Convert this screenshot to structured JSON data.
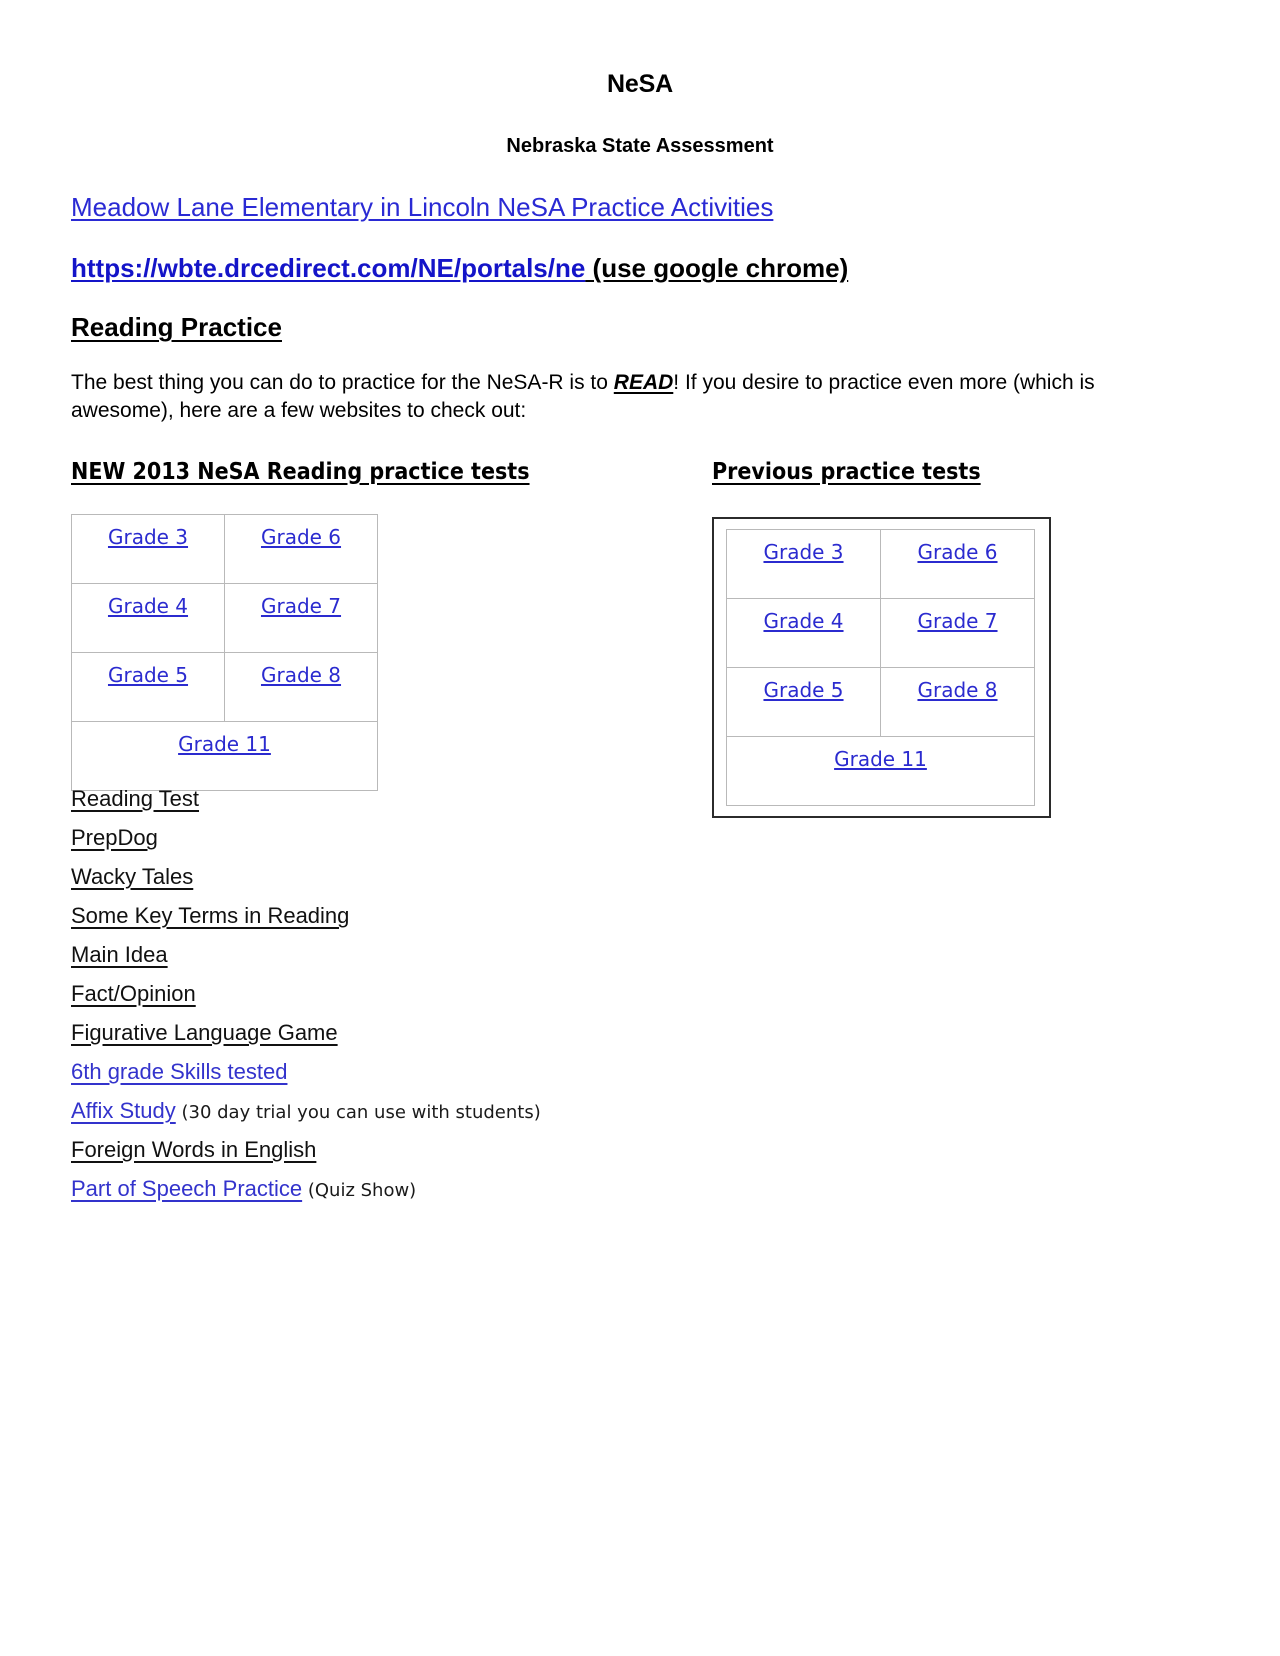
{
  "document": {
    "title": "NeSA",
    "subtitle": "Nebraska State Assessment",
    "lead_link": "Meadow Lane Elementary in Lincoln NeSA Practice Activities",
    "url_text": "https://wbte.drcedirect.com/NE/portals/ne",
    "url_note": " (use google chrome)",
    "section_heading": "Reading Practice",
    "paragraph": {
      "part1": "The best thing you can do to practice for the NeSA-R is to ",
      "emphasis": "READ",
      "part2": "!   If you desire to practice even more (which is awesome), here are a few websites to check out:"
    }
  },
  "columns": {
    "left": {
      "heading": "NEW 2013 NeSA Reading practice tests ",
      "table": {
        "rows": [
          [
            "Grade 3",
            "Grade 6"
          ],
          [
            "Grade 4",
            "Grade 7"
          ],
          [
            "Grade 5",
            "Grade 8"
          ]
        ],
        "full_width_row": "Grade 11"
      }
    },
    "right": {
      "heading": "Previous practice tests",
      "table": {
        "rows": [
          [
            "Grade 3",
            "Grade 6"
          ],
          [
            "Grade 4",
            "Grade 7"
          ],
          [
            "Grade 5",
            "Grade 8"
          ]
        ],
        "full_width_row": "Grade 11"
      }
    }
  },
  "resource_links": [
    {
      "label": " Reading Test",
      "color": "black",
      "note": ""
    },
    {
      "label": "PrepDog",
      "color": "black",
      "note": ""
    },
    {
      "label": "Wacky Tales",
      "color": "black",
      "note": ""
    },
    {
      "label": "Some Key Terms in Reading",
      "color": "black",
      "note": ""
    },
    {
      "label": "Main Idea",
      "color": "black",
      "note": ""
    },
    {
      "label": "Fact/Opinion",
      "color": "black",
      "note": ""
    },
    {
      "label": "Figurative Language Game",
      "color": "black",
      "note": ""
    },
    {
      "label": "6th grade Skills tested",
      "color": "blue",
      "note": ""
    },
    {
      "label": "Affix Study",
      "color": "blue",
      "note": " (30 day trial you can use with students)"
    },
    {
      "label": "Foreign Words in English",
      "color": "black",
      "note": ""
    },
    {
      "label": "Part of Speech Practice",
      "color": "blue",
      "note": " (Quiz Show)"
    }
  ],
  "colors": {
    "link_blue": "#2b2bcf",
    "visited_black": "#111111",
    "table_border": "#b9b9b9",
    "outer_border": "#2b2b2b"
  }
}
